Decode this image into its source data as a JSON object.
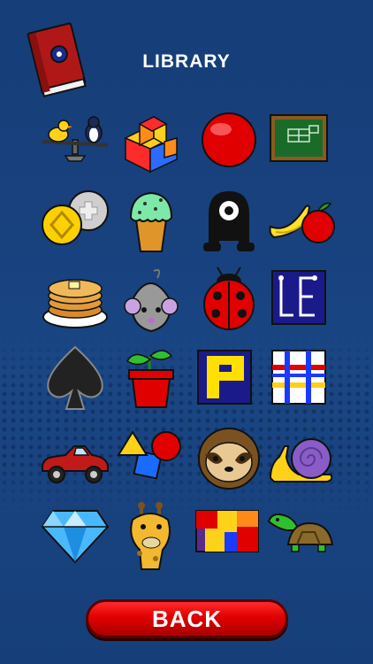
{
  "header": {
    "title": "LIBRARY"
  },
  "back_button": {
    "label": "BACK"
  },
  "book_icon": {
    "name": "library-book-icon",
    "color": "#b01818"
  },
  "library_items": [
    {
      "name": "duck-penguin-scale"
    },
    {
      "name": "stacked-blocks"
    },
    {
      "name": "red-ball"
    },
    {
      "name": "chalkboard"
    },
    {
      "name": "coins"
    },
    {
      "name": "ice-cream-cone"
    },
    {
      "name": "one-eyed-monster"
    },
    {
      "name": "banana-apple"
    },
    {
      "name": "pancakes"
    },
    {
      "name": "mouse"
    },
    {
      "name": "ladybug"
    },
    {
      "name": "le-puzzle"
    },
    {
      "name": "spade"
    },
    {
      "name": "potted-sprout"
    },
    {
      "name": "p-puzzle"
    },
    {
      "name": "grid-puzzle"
    },
    {
      "name": "red-car"
    },
    {
      "name": "shapes"
    },
    {
      "name": "sloth"
    },
    {
      "name": "snail"
    },
    {
      "name": "diamond"
    },
    {
      "name": "giraffe"
    },
    {
      "name": "jigsaw-blocks"
    },
    {
      "name": "turtle"
    }
  ],
  "colors": {
    "background": "#18427f",
    "button": "#e00000",
    "title_text": "#ffffff"
  }
}
